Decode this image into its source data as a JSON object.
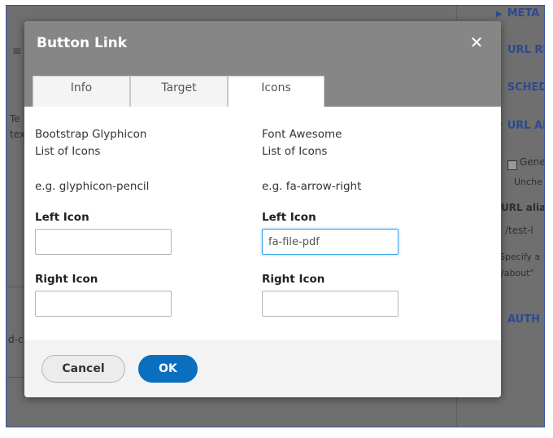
{
  "modal": {
    "title": "Button Link",
    "close_glyph": "✕",
    "tabs": [
      {
        "label": "Info",
        "active": false
      },
      {
        "label": "Target",
        "active": false
      },
      {
        "label": "Icons",
        "active": true
      }
    ]
  },
  "glyphicon": {
    "heading_line1": "Bootstrap Glyphicon",
    "heading_line2": "List of Icons",
    "example": "e.g. glyphicon-pencil",
    "left_icon_label": "Left Icon",
    "left_icon_value": "",
    "right_icon_label": "Right Icon",
    "right_icon_value": ""
  },
  "fontawesome": {
    "heading_line1": "Font Awesome",
    "heading_line2": "List of Icons",
    "example": "e.g. fa-arrow-right",
    "left_icon_label": "Left Icon",
    "left_icon_value": "fa-file-pdf",
    "right_icon_label": "Right Icon",
    "right_icon_value": ""
  },
  "footer": {
    "cancel_label": "Cancel",
    "ok_label": "OK"
  },
  "background": {
    "sections": [
      "META",
      "URL RI",
      "SCHED",
      "URL AL",
      "AUTH"
    ],
    "generate_label": "Gener",
    "uncheck_text": "Unche",
    "url_alias_label": "URL alia",
    "url_alias_value": "/test-l",
    "specify_text": "Specify a",
    "about_text": "/about\"",
    "left_text_1": "Te",
    "left_text_2": "tex",
    "left_text_3": "d-c"
  },
  "colors": {
    "header_bg": "#868686",
    "primary_button": "#0a6fbf",
    "focus_border": "#40a6e8"
  }
}
